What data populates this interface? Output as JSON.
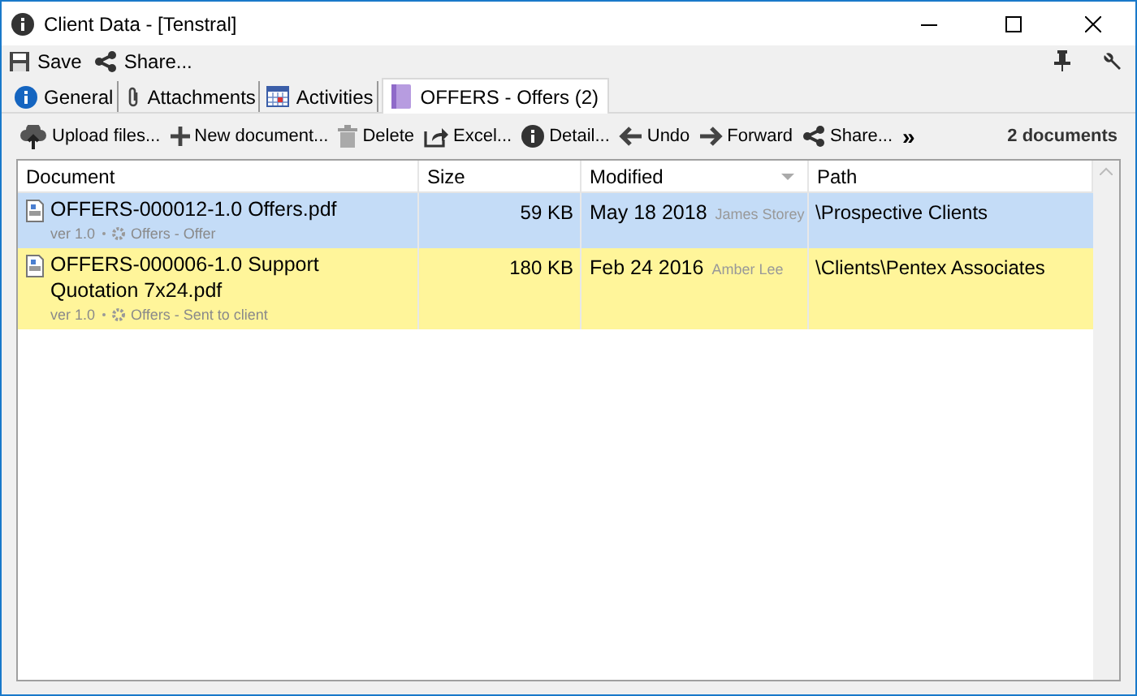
{
  "window": {
    "title": "Client Data - [Tenstral]"
  },
  "toolbar": [
    {
      "label": "Save",
      "kind": "save"
    },
    {
      "label": "Share...",
      "kind": "share"
    }
  ],
  "tabs": [
    {
      "label": "General",
      "kind": "info",
      "selected": false
    },
    {
      "label": "Attachments",
      "kind": "clip",
      "selected": false
    },
    {
      "label": "Activities",
      "kind": "calendar",
      "selected": false
    },
    {
      "label": "OFFERS - Offers (2)",
      "kind": "folder",
      "selected": true
    }
  ],
  "actions": [
    {
      "label": "Upload files...",
      "kind": "upload"
    },
    {
      "label": "New document...",
      "kind": "plus"
    },
    {
      "label": "Delete",
      "kind": "trash"
    },
    {
      "label": "Excel...",
      "kind": "export"
    },
    {
      "label": "Detail...",
      "kind": "info"
    },
    {
      "label": "Undo",
      "kind": "back"
    },
    {
      "label": "Forward",
      "kind": "forward"
    },
    {
      "label": "Share...",
      "kind": "share"
    },
    {
      "label": "»",
      "kind": "more"
    }
  ],
  "document_count": "2 documents",
  "table": {
    "columns": [
      "Document",
      "Size",
      "Modified",
      "Path"
    ],
    "rows": [
      {
        "name": "OFFERS-000012-1.0 Offers.pdf",
        "version": "ver 1.0",
        "category": "Offers - Offer",
        "size": "59 KB",
        "date": "May 18 2018",
        "author": "James Storey",
        "path": "\\Prospective Clients",
        "color": "#c4dcf7"
      },
      {
        "name": "OFFERS-000006-1.0 Support Quotation 7x24.pdf",
        "version": "ver 1.0",
        "category": "Offers - Sent to client",
        "size": "180 KB",
        "date": "Feb 24 2016",
        "author": "Amber Lee",
        "path": "\\Clients\\Pentex Associates",
        "color": "#fff59a"
      }
    ]
  }
}
